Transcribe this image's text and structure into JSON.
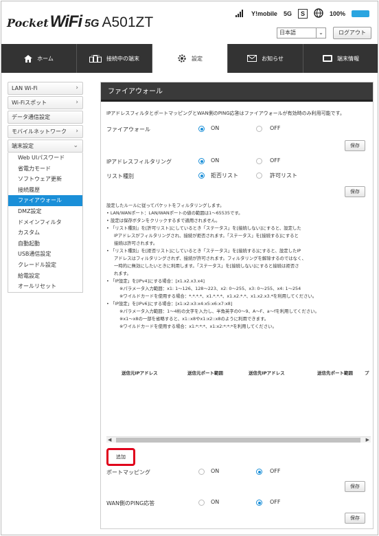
{
  "header": {
    "logo": {
      "pocket": "Pocket",
      "wifi": "WiFi",
      "fiveg": "5G",
      "model": "A501ZT"
    },
    "status": {
      "carrier": "Y!mobile",
      "network": "5G",
      "sim": "S",
      "battery": "100%"
    },
    "language": "日本語",
    "logout": "ログアウト"
  },
  "nav": [
    {
      "label": "ホーム",
      "icon": "home-icon"
    },
    {
      "label": "接続中の端末",
      "icon": "devices-icon"
    },
    {
      "label": "設定",
      "icon": "gear-icon"
    },
    {
      "label": "お知らせ",
      "icon": "mail-icon"
    },
    {
      "label": "端末情報",
      "icon": "device-info-icon"
    }
  ],
  "sidebar": {
    "items": [
      {
        "label": "LAN Wi-Fi",
        "chev": "›"
      },
      {
        "label": "Wi-Fiスポット",
        "chev": "›"
      },
      {
        "label": "データ通信設定",
        "chev": ""
      },
      {
        "label": "モバイルネットワーク",
        "chev": "›"
      },
      {
        "label": "端末設定",
        "chev": "⌄"
      }
    ],
    "sub": [
      "Web UIパスワード",
      "省電力モード",
      "ソフトウェア更新",
      "接続履歴",
      "ファイアウォール",
      "DMZ設定",
      "ドメインフィルタ",
      "カスタム",
      "自動起動",
      "USB通信設定",
      "クレードル設定",
      "給電設定",
      "オールリセット"
    ],
    "active_sub": "ファイアウォール"
  },
  "main": {
    "title": "ファイアウォール",
    "intro": "IPアドレスフィルタとポートマッピングとWAN側のPING応答はファイアウォールが有効時のみ利用可能です。",
    "firewall": {
      "label": "ファイアウォール",
      "on": "ON",
      "off": "OFF",
      "selected": "on"
    },
    "ip_filter": {
      "label": "IPアドレスフィルタリング",
      "on": "ON",
      "off": "OFF",
      "selected": "on"
    },
    "list_type": {
      "label": "リスト種別",
      "deny": "拒否リスト",
      "allow": "許可リスト",
      "selected": "deny"
    },
    "save": "保存",
    "rules": [
      "設定したルールに従ってパケットをフィルタリングします。",
      "LAN/WANポート：LAN/WANポートの値の範囲は1～65535です。",
      "設定は保存ボタンをクリックするまで適用されません。",
      "「リスト種別」を[許可リスト]にしているとき「ステータス」を[接続しない]にすると、設定した",
      "IPアドレスがフィルタリングされ、接続が拒否されます。「ステータス」を[接続する]にすると",
      "接続は許可されます。",
      "「リスト種別」を[拒否リスト]にしているとき「ステータス」を[接続する]にすると、設定したIP",
      "アドレスはフィルタリングされず、接続が許可されます。フィルタリングを解除するのではなく、",
      "一時的に無効にしたいときに利用します。「ステータス」を[接続しない]にすると接続は拒否さ",
      "れます。",
      "「IP設定」を[IPv4]にする場合：[x1.x2.x3.x4]",
      "※パラメータ入力範囲：x1: 1～126、128～223、x2: 0～255、x3: 0～255、x4: 1～254",
      "※ワイルドカードを使用する場合：*.*.*.*、x1.*.*.*、x1.x2.*.*、x1.x2.x3.*を利用してください。",
      "「IP設定」を[IPv6]にする場合：[x1:x2:x3:x4:x5:x6:x7:x8]",
      "※パラメータ入力範囲：1～4桁の文字を入力し、半角英字の0～9、A～F、a～fを利用してください。",
      "※x1～x8の一部を省略すると、x1::x8やx1:x2::x8のように利用できます。",
      "※ワイルドカードを使用する場合：x1:*:*:*、x1:x2:*:*:*を利用してください。"
    ],
    "table_headers": [
      "送信元IPアドレス",
      "送信元ポート範囲",
      "送信先IPアドレス",
      "送信先ポート範囲",
      "プ"
    ],
    "add": "追加",
    "port_mapping": {
      "label": "ポートマッピング",
      "on": "ON",
      "off": "OFF",
      "selected": "off"
    },
    "wan_ping": {
      "label": "WAN側のPING応答",
      "on": "ON",
      "off": "OFF",
      "selected": "off"
    }
  },
  "colors": {
    "accent": "#1a8fd8",
    "nav_bg": "#333333",
    "highlight": "#e0001b"
  }
}
